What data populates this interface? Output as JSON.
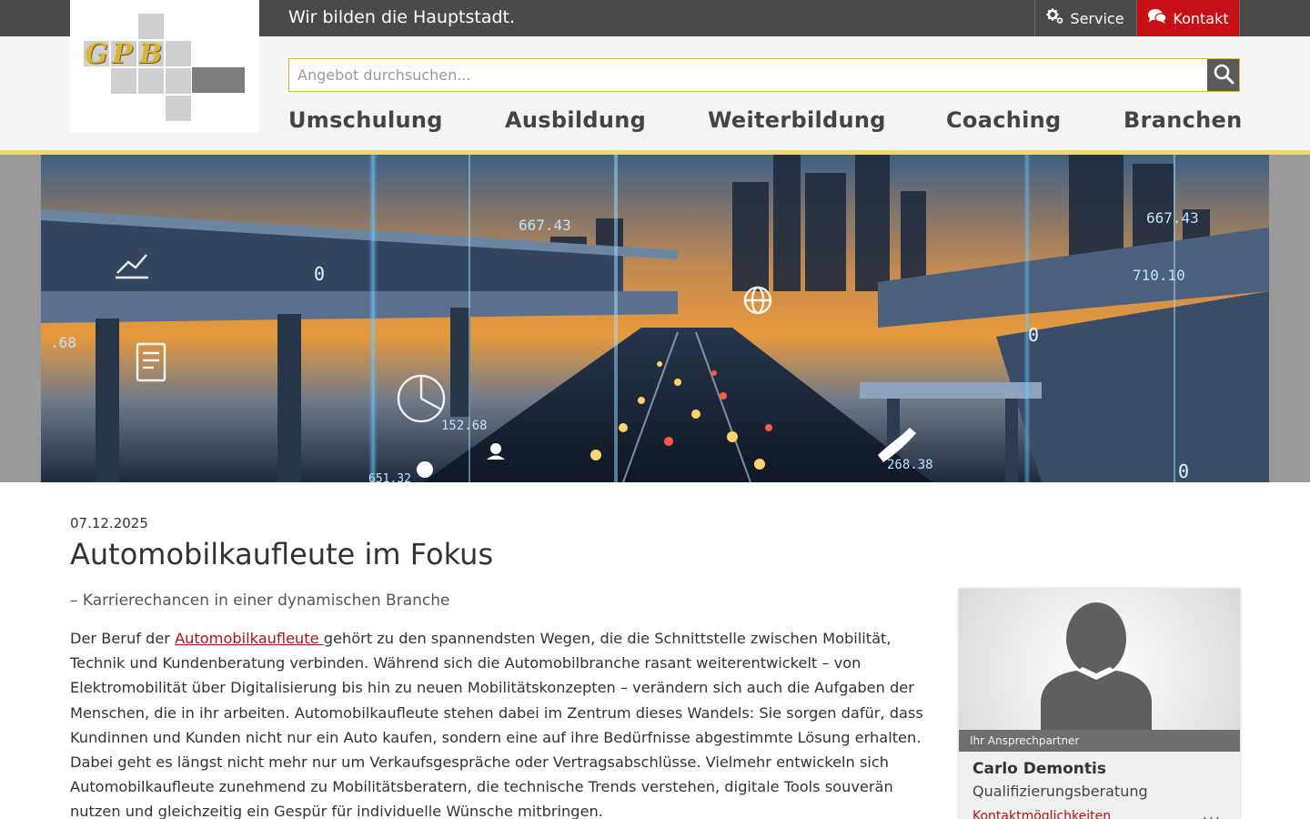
{
  "header": {
    "tagline": "Wir bilden die Hauptstadt.",
    "service_label": "Service",
    "kontakt_label": "Kontakt",
    "logo_letters": [
      "G",
      "P",
      "B"
    ]
  },
  "search": {
    "placeholder": "Angebot durchsuchen...",
    "value": ""
  },
  "nav": {
    "items": [
      "Umschulung",
      "Ausbildung",
      "Weiterbildung",
      "Coaching",
      "Branchen"
    ]
  },
  "hero": {
    "overlay_numbers": [
      "667.43",
      "667.43",
      "710.10",
      ".68",
      "152.68",
      "268.38",
      "651.32",
      "0",
      "0",
      "0"
    ]
  },
  "article": {
    "date": "07.12.2025",
    "title": "Automobilkaufleute im Fokus",
    "subtitle": "– Karrierechancen in einer dynamischen Branche",
    "para_start": "Der Beruf der ",
    "para_link": "Automobilkaufleute ",
    "para_rest": "gehört zu den spannendsten Wegen, die die Schnittstelle zwischen Mobilität, Technik und Kundenberatung verbinden. Während sich die Automobilbranche rasant weiterentwickelt – von Elektromobilität über Digitalisierung bis hin zu neuen Mobilitätskonzepten – verändern sich auch die Aufgaben der Menschen, die in ihr arbeiten. Automobilkaufleute stehen dabei im Zentrum dieses Wandels: Sie sorgen dafür, dass Kundinnen und Kunden nicht nur ein Auto kaufen, sondern eine auf ihre Bedürfnisse abgestimmte Lösung erhalten. Dabei geht es längst nicht mehr nur um Verkaufsgespräche oder Vertragsabschlüsse. Vielmehr entwickeln sich Automobilkaufleute zunehmend zu Mobilitätsberatern, die technische Trends verstehen, digitale Tools souverän nutzen und gleichzeitig ein Gespür für individuelle Wünsche mitbringen."
  },
  "contact_card": {
    "label": "Ihr Ansprechpartner",
    "name": "Carlo Demontis",
    "role": "Qualifizierungsberatung",
    "link": "Kontaktmöglichkeiten",
    "more": "..."
  },
  "colors": {
    "topbar": "#4a4a4a",
    "kontakt": "#c70f16",
    "accent_yellow": "#f0d96c",
    "link_red": "#b01218"
  },
  "icons": [
    "gears-icon",
    "chat-bubbles-icon",
    "search-icon",
    "person-silhouette-icon"
  ]
}
